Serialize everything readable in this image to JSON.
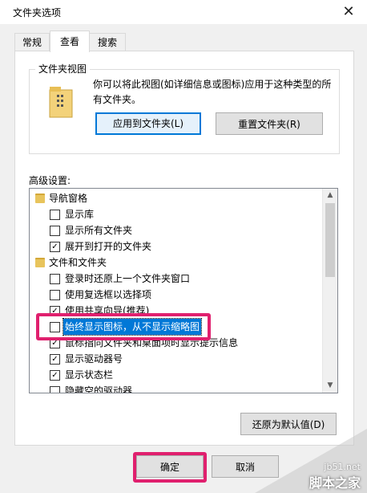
{
  "window": {
    "title": "文件夹选项"
  },
  "tabs": [
    {
      "label": "常规"
    },
    {
      "label": "查看"
    },
    {
      "label": "搜索"
    }
  ],
  "folder_views": {
    "group_title": "文件夹视图",
    "description": "你可以将此视图(如详细信息或图标)应用于这种类型的所有文件夹。",
    "apply_label": "应用到文件夹(L)",
    "reset_label": "重置文件夹(R)"
  },
  "advanced": {
    "label": "高级设置:",
    "items": [
      {
        "text": "导航窗格",
        "type": "folder",
        "checked": false
      },
      {
        "text": "显示库",
        "type": "checkbox",
        "checked": false
      },
      {
        "text": "显示所有文件夹",
        "type": "checkbox",
        "checked": false
      },
      {
        "text": "展开到打开的文件夹",
        "type": "checkbox",
        "checked": true
      },
      {
        "text": "文件和文件夹",
        "type": "folder",
        "checked": false
      },
      {
        "text": "登录时还原上一个文件夹窗口",
        "type": "checkbox",
        "checked": false
      },
      {
        "text": "使用复选框以选择项",
        "type": "checkbox",
        "checked": false
      },
      {
        "text": "使用共享向导(推荐)",
        "type": "checkbox",
        "checked": true
      },
      {
        "text": "始终显示图标，从不显示缩略图",
        "type": "checkbox",
        "checked": false,
        "selected": true
      },
      {
        "text": "鼠标指向文件夹和桌面项时显示提示信息",
        "type": "checkbox",
        "checked": true
      },
      {
        "text": "显示驱动器号",
        "type": "checkbox",
        "checked": true
      },
      {
        "text": "显示状态栏",
        "type": "checkbox",
        "checked": true
      },
      {
        "text": "隐藏空的驱动器",
        "type": "checkbox",
        "checked": false
      }
    ],
    "restore_label": "还原为默认值(D)"
  },
  "footer": {
    "ok_label": "确定",
    "cancel_label": "取消"
  },
  "watermark": {
    "line1": "jb51.net",
    "line2": "脚本之家"
  },
  "colors": {
    "highlight": "#e0206e",
    "selection": "#0078d7"
  }
}
